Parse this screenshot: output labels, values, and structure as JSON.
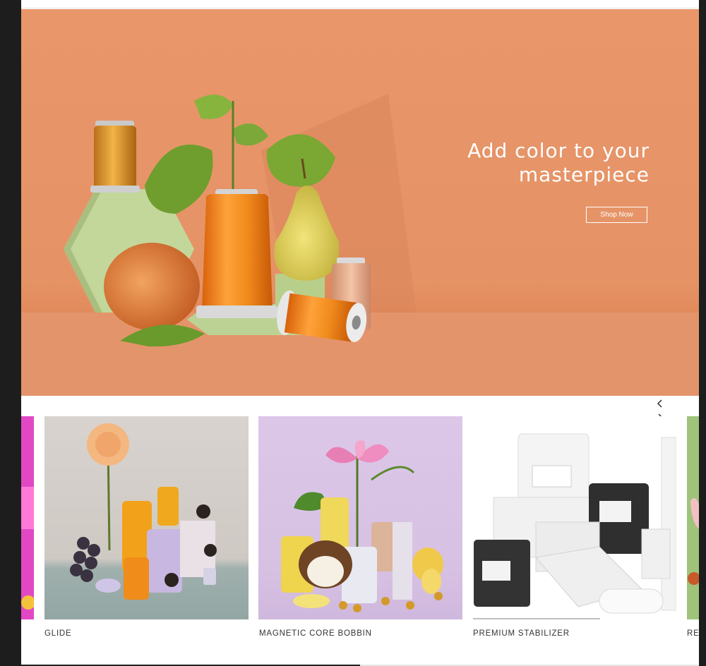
{
  "hero": {
    "title": "Add color to your masterpiece",
    "cta_label": "Shop Now",
    "background_color": "#e8966a"
  },
  "carousel": {
    "prev_icon": "chevron-left-icon",
    "next_icon": "chevron-right-icon",
    "items": [
      {
        "label": "GLIDE"
      },
      {
        "label": "MAGNETIC CORE BOBBIN"
      },
      {
        "label": "PREMIUM STABILIZER"
      },
      {
        "label": "RE"
      }
    ],
    "progress_fraction": 0.5
  },
  "colors": {
    "accent_orange": "#f08a1c",
    "lavender": "#d9b7e2",
    "sage": "#b9d08e"
  }
}
